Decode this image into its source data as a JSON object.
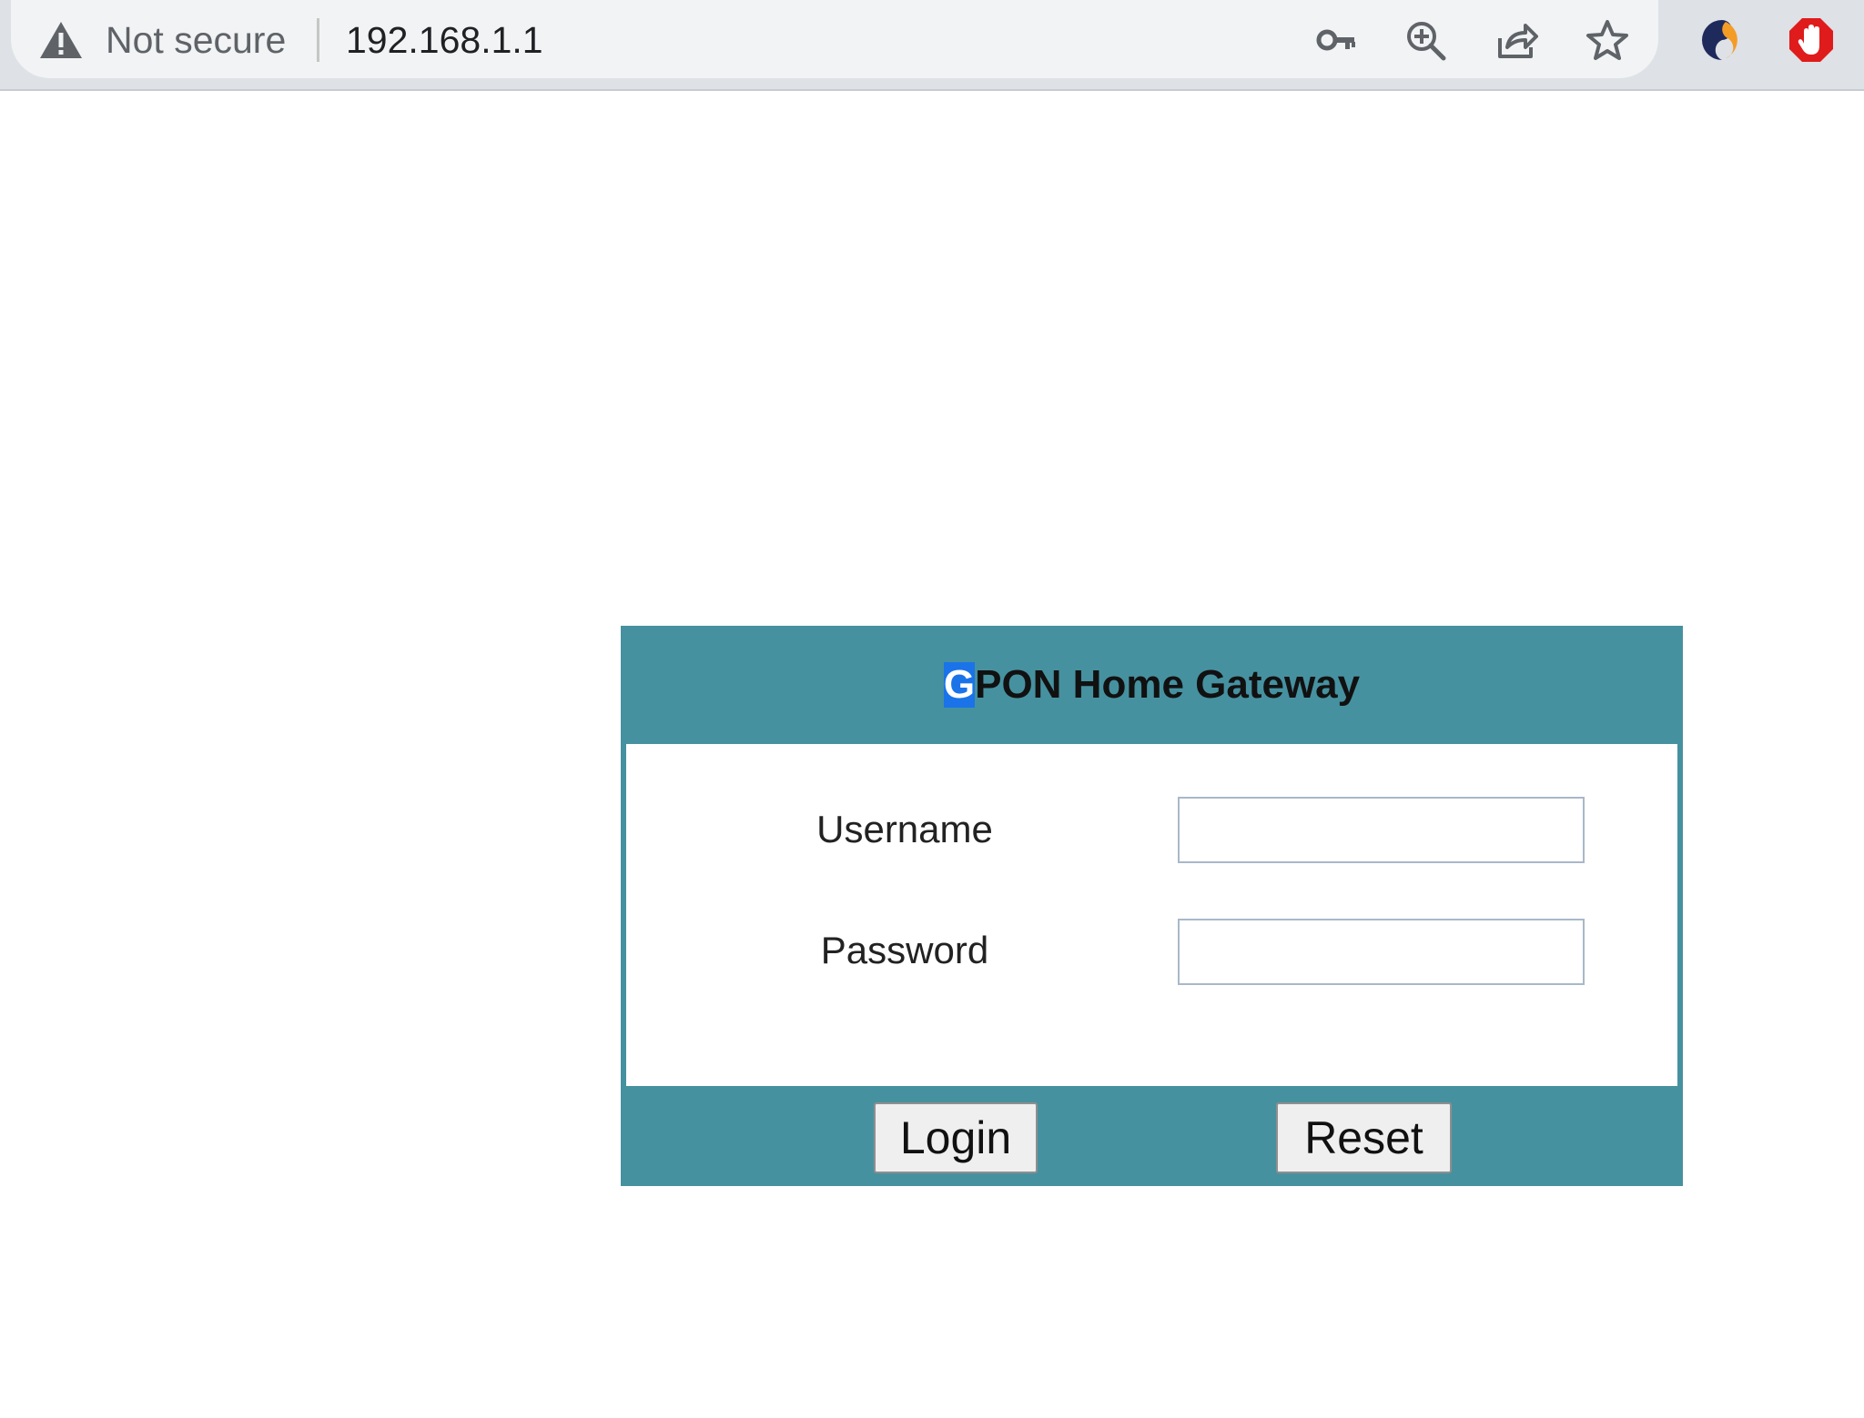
{
  "browser": {
    "security_label": "Not secure",
    "url": "192.168.1.1",
    "icons": [
      "warning-triangle-icon",
      "key-icon",
      "zoom-in-icon",
      "share-icon",
      "star-icon",
      "extension-icon",
      "adblock-icon"
    ]
  },
  "login": {
    "title_first_char": "G",
    "title_rest": "PON Home Gateway",
    "username_label": "Username",
    "username_value": "",
    "password_label": "Password",
    "password_value": "",
    "login_button": "Login",
    "reset_button": "Reset",
    "colors": {
      "panel": "#4691a0",
      "selection": "#1a73e8"
    }
  }
}
